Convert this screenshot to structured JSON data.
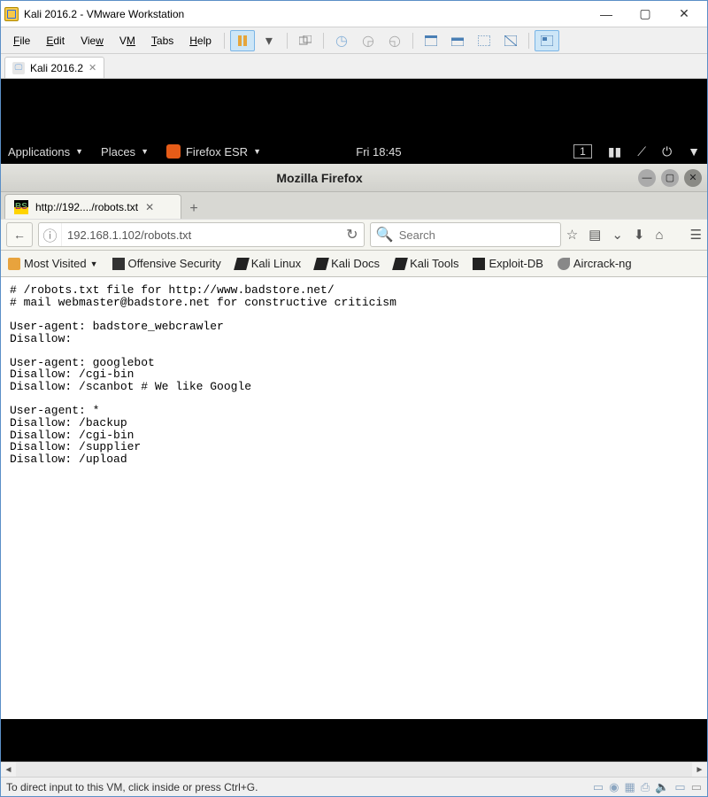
{
  "vmware": {
    "title": "Kali 2016.2 - VMware Workstation",
    "menu": {
      "file": "File",
      "edit": "Edit",
      "view": "View",
      "vm": "VM",
      "tabs": "Tabs",
      "help": "Help"
    },
    "tab": {
      "label": "Kali 2016.2"
    },
    "status": "To direct input to this VM, click inside or press Ctrl+G."
  },
  "kali": {
    "applications": "Applications",
    "places": "Places",
    "app_label": "Firefox ESR",
    "clock": "Fri 18:45",
    "workspace": "1"
  },
  "firefox": {
    "title": "Mozilla Firefox",
    "tab_label": "http://192..../robots.txt",
    "url": "192.168.1.102/robots.txt",
    "search_placeholder": "Search",
    "bookmarks": {
      "most_visited": "Most Visited",
      "offsec": "Offensive Security",
      "kali_linux": "Kali Linux",
      "kali_docs": "Kali Docs",
      "kali_tools": "Kali Tools",
      "exploit_db": "Exploit-DB",
      "aircrack": "Aircrack-ng"
    },
    "page_text": "# /robots.txt file for http://www.badstore.net/\n# mail webmaster@badstore.net for constructive criticism\n\nUser-agent: badstore_webcrawler\nDisallow:\n\nUser-agent: googlebot\nDisallow: /cgi-bin\nDisallow: /scanbot # We like Google\n\nUser-agent: *\nDisallow: /backup\nDisallow: /cgi-bin\nDisallow: /supplier\nDisallow: /upload"
  }
}
